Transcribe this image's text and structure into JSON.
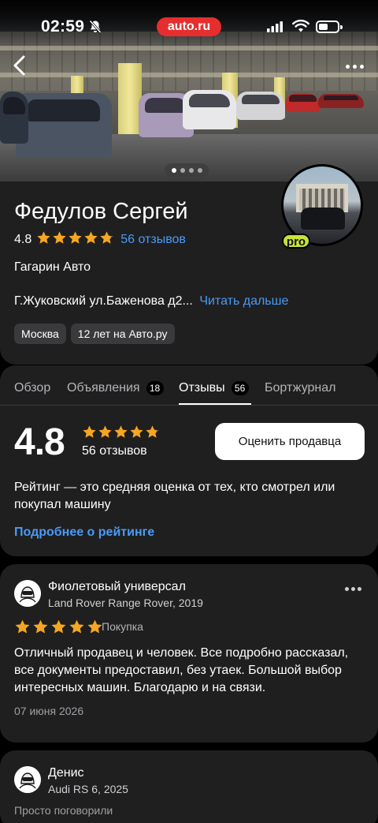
{
  "status_bar": {
    "time": "02:59",
    "brand": "auto.ru",
    "icons": [
      "bell-off-icon",
      "signal-icon",
      "wifi-icon",
      "battery-icon"
    ],
    "battery_level": 0.5
  },
  "hero": {
    "icons": [
      "back-arrow-icon",
      "more-icon"
    ],
    "gallery_pages": 4,
    "gallery_active_index": 0
  },
  "seller": {
    "name": "Федулов Сергей",
    "rating": "4.8",
    "rating_value": 4.8,
    "reviews_link": "56 отзывов",
    "company": "Гагарин Авто",
    "address": "Г.Жуковский ул.Баженова д2...",
    "read_more": "Читать дальше",
    "chips": [
      "Москва",
      "12 лет на Авто.ру"
    ],
    "badge": "pro"
  },
  "tabs": [
    {
      "label": "Обзор",
      "count": ""
    },
    {
      "label": "Объявления",
      "count": "18"
    },
    {
      "label": "Отзывы",
      "count": "56"
    },
    {
      "label": "Бортжурнал",
      "count": ""
    }
  ],
  "active_tab": "Отзывы",
  "rating_block": {
    "value": "4.8",
    "count": "56 отзывов",
    "rate_button": "Оценить продавца",
    "description": "Рейтинг — это средняя оценка от тех, кто смотрел или покупал машину",
    "more_link": "Подробнее о рейтинге"
  },
  "reviews": [
    {
      "author": "Фиолетовый универсал",
      "car": "Land Rover Range Rover, 2019",
      "stars": 5,
      "tag": "Покупка",
      "text": "Отличный продавец и человек. Все подробно рассказал, все документы предоставил, без утаек. Большой выбор интересных машин. Благодарю и на связи.",
      "date": "07 июня 2026"
    },
    {
      "author": "Денис",
      "car": "Audi RS 6, 2025",
      "status": "Просто поговорили"
    }
  ],
  "colors": {
    "background": "#000000",
    "card": "#1f1f20",
    "accent_link": "#4a9bf5",
    "star": "#f5a623",
    "brand_red": "#e62e2e",
    "pro_badge": "#c8e23a"
  }
}
